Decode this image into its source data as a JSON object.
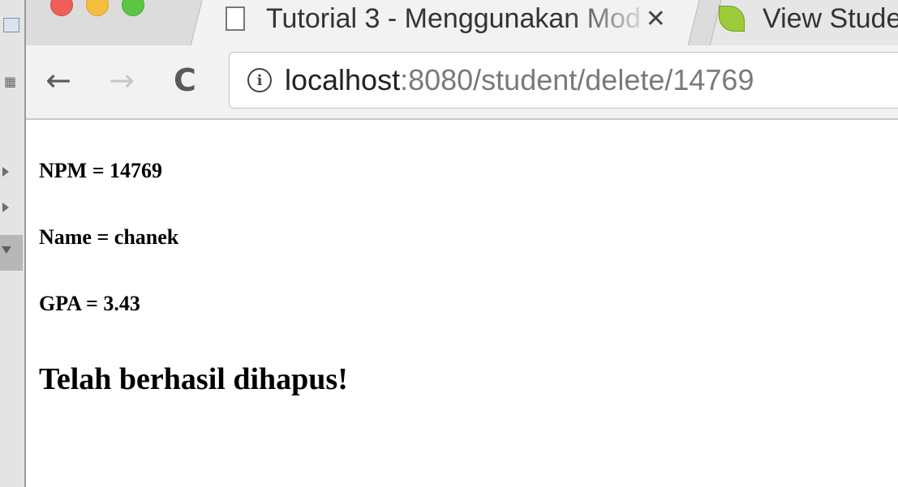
{
  "browser": {
    "tabs": [
      {
        "title": "Tutorial 3 - Menggunakan Mod",
        "close": "✕",
        "active": true
      },
      {
        "title": "View Stude",
        "active": false
      }
    ],
    "nav": {
      "back": "←",
      "forward": "→",
      "reload": "C"
    },
    "address": {
      "info": "i",
      "host": "localhost",
      "rest": ":8080/student/delete/14769"
    }
  },
  "page": {
    "npm": "NPM = 14769",
    "name": "Name = chanek",
    "gpa": "GPA = 3.43",
    "message": "Telah berhasil dihapus!"
  }
}
